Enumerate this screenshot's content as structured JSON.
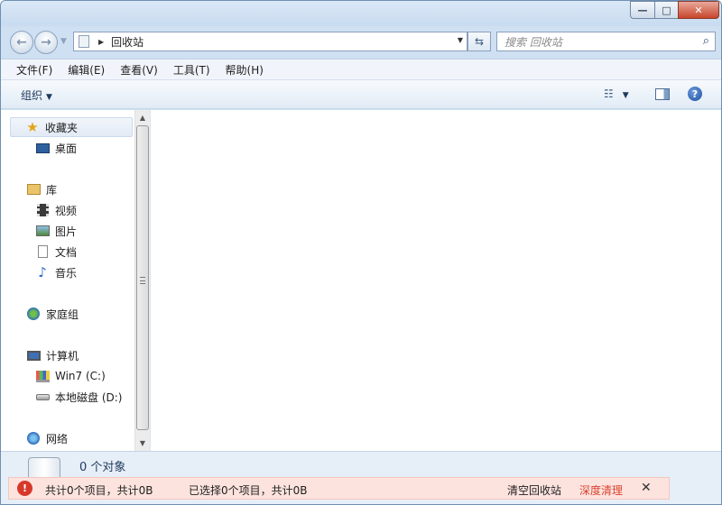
{
  "window": {
    "min_glyph": "—",
    "max_glyph": "□",
    "close_glyph": "✕"
  },
  "address": {
    "location": "回收站",
    "search_placeholder": "搜索 回收站"
  },
  "menu": [
    {
      "label": "文件(F)"
    },
    {
      "label": "编辑(E)"
    },
    {
      "label": "查看(V)"
    },
    {
      "label": "工具(T)"
    },
    {
      "label": "帮助(H)"
    }
  ],
  "toolbar": {
    "organize_label": "组织"
  },
  "nav": {
    "favorites": "收藏夹",
    "desktop": "桌面",
    "libraries": "库",
    "videos": "视频",
    "pictures": "图片",
    "documents": "文档",
    "music": "音乐",
    "homegroup": "家庭组",
    "computer": "计算机",
    "drive_c": "Win7 (C:)",
    "drive_d": "本地磁盘 (D:)",
    "network": "网络"
  },
  "details": {
    "object_count": "0 个对象"
  },
  "status": {
    "total": "共计0个项目，共计0B",
    "selected": "已选择0个项目，共计0B",
    "empty_bin": "清空回收站",
    "deep_clean": "深度清理",
    "deep_clean_color": "#d9422f"
  }
}
